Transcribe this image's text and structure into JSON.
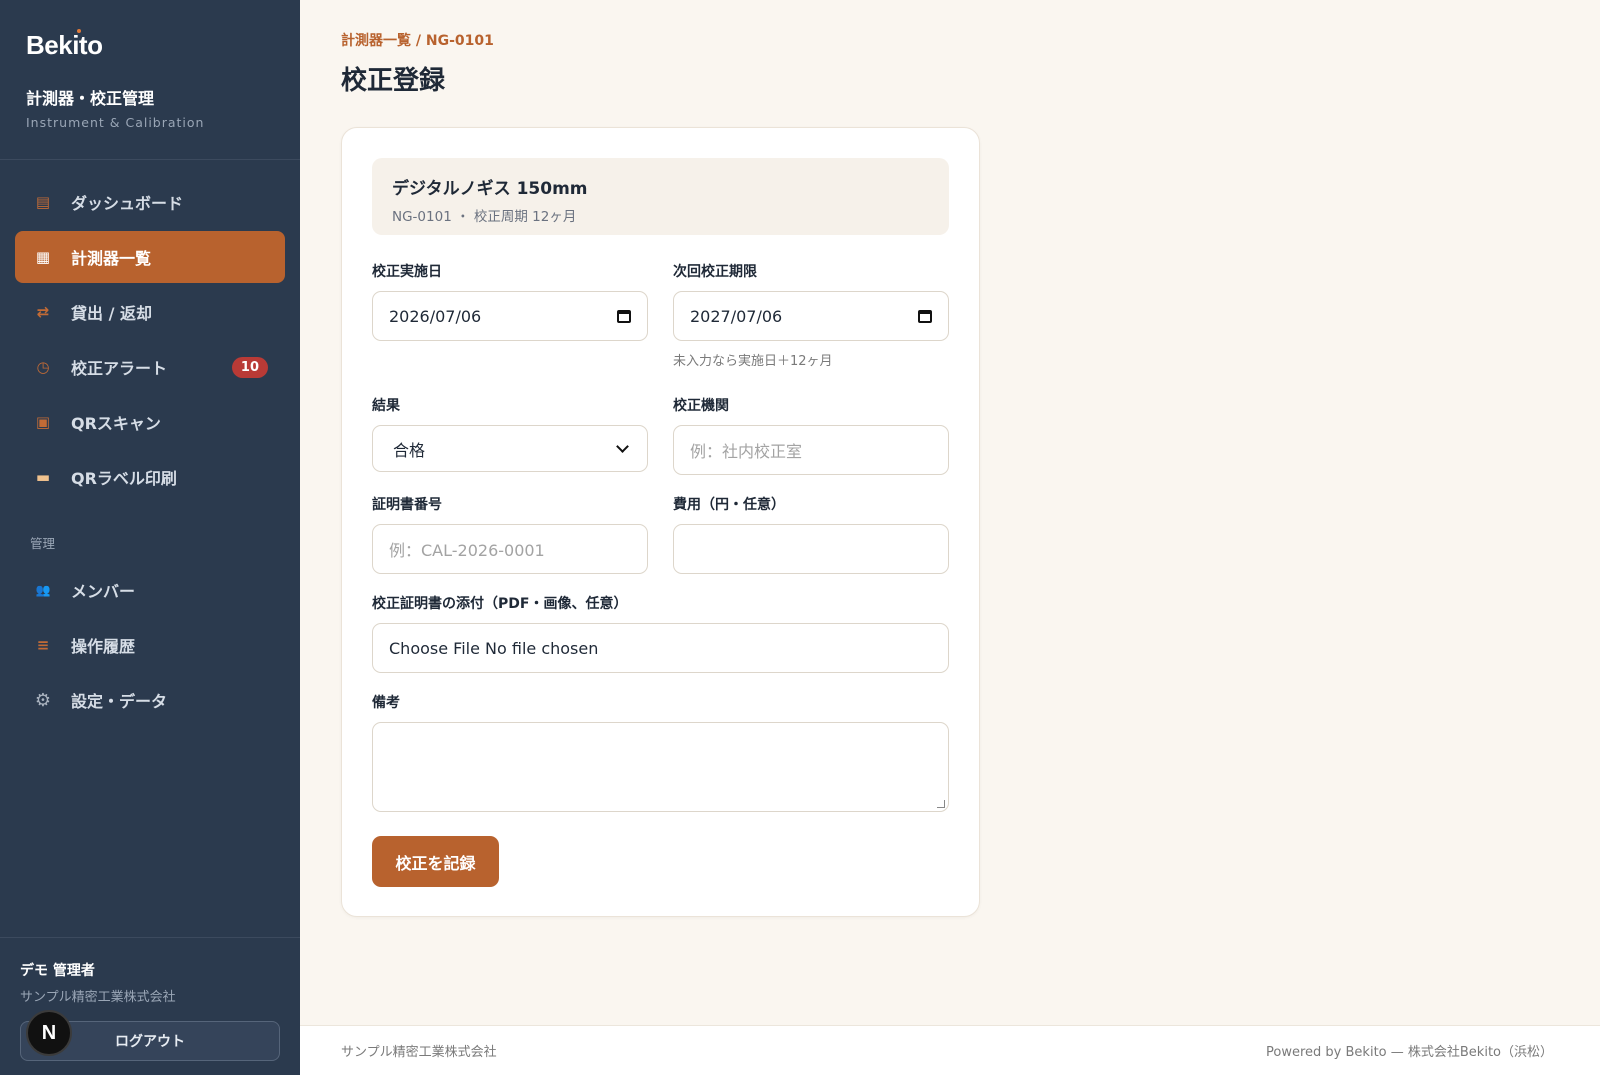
{
  "sidebar": {
    "logo": "Bekito",
    "app_name": "計測器・校正管理",
    "app_sub": "Instrument & Calibration",
    "items": [
      {
        "label": "ダッシュボード",
        "icon": "▤"
      },
      {
        "label": "計測器一覧",
        "icon": "▦"
      },
      {
        "label": "貸出 / 返却",
        "icon": "⇄"
      },
      {
        "label": "校正アラート",
        "icon": "◷",
        "badge": "10"
      },
      {
        "label": "QRスキャン",
        "icon": "▣"
      },
      {
        "label": "QRラベル印刷",
        "icon": "▬"
      }
    ],
    "section_label": "管理",
    "admin_items": [
      {
        "label": "メンバー",
        "icon": "👥"
      },
      {
        "label": "操作履歴",
        "icon": "≡"
      },
      {
        "label": "設定・データ",
        "icon": "⚙"
      }
    ],
    "user_name": "デモ 管理者",
    "user_org": "サンプル精密工業株式会社",
    "logout": "ログアウト",
    "avatar_letter": "N"
  },
  "header": {
    "breadcrumb": "計測器一覧 / NG-0101",
    "title": "校正登録"
  },
  "instrument": {
    "name": "デジタルノギス 150mm",
    "meta": "NG-0101 ・ 校正周期 12ヶ月"
  },
  "form": {
    "date_label": "校正実施日",
    "date_value": "2026/07/06",
    "next_label": "次回校正期限",
    "next_value": "2027/07/06",
    "next_hint": "未入力なら実施日＋12ヶ月",
    "result_label": "結果",
    "result_value": "合格",
    "org_label": "校正機関",
    "org_placeholder": "例：社内校正室",
    "cert_label": "証明書番号",
    "cert_placeholder": "例：CAL-2026-0001",
    "cost_label": "費用（円・任意）",
    "cost_value": "",
    "attach_label": "校正証明書の添付（PDF・画像、任意）",
    "attach_value": "Choose File No file chosen",
    "note_label": "備考",
    "submit": "校正を記録"
  },
  "footer": {
    "left": "サンプル精密工業株式会社",
    "right": "Powered by Bekito — 株式会社Bekito（浜松）"
  },
  "colors": {
    "accent": "#b8622e",
    "sidebar": "#2b3a4e",
    "badge": "#b93a36",
    "background": "#faf6f0"
  }
}
